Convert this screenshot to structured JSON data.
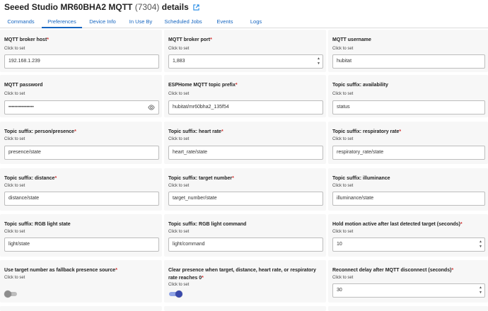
{
  "header": {
    "title": "Seeed Studio MR60BHA2 MQTT",
    "device_id": "(7304)",
    "suffix": "details",
    "link_icon": "external-link-icon"
  },
  "tabs": [
    {
      "label": "Commands"
    },
    {
      "label": "Preferences"
    },
    {
      "label": "Device Info"
    },
    {
      "label": "In Use By"
    },
    {
      "label": "Scheduled Jobs"
    },
    {
      "label": "Events"
    },
    {
      "label": "Logs"
    }
  ],
  "active_tab": "Preferences",
  "common": {
    "click_to_set": "Click to set",
    "required_mark": "*"
  },
  "prefs": {
    "broker_host": {
      "label": "MQTT broker host",
      "value": "192.168.1.239"
    },
    "broker_port": {
      "label": "MQTT broker port",
      "value": "1,883"
    },
    "username": {
      "label": "MQTT username",
      "value": "hubitat"
    },
    "password": {
      "label": "MQTT password",
      "value": "•••••••••••••••••"
    },
    "topic_prefix": {
      "label": "ESPHome MQTT topic prefix",
      "value": "hubitat/mr60bha2_135f54"
    },
    "availability": {
      "label": "Topic suffix: availability",
      "value": "status"
    },
    "presence": {
      "label": "Topic suffix: person/presence",
      "value": "presence/state"
    },
    "heart_rate": {
      "label": "Topic suffix: heart rate",
      "value": "heart_rate/state"
    },
    "resp_rate": {
      "label": "Topic suffix: respiratory rate",
      "value": "respiratory_rate/state"
    },
    "distance": {
      "label": "Topic suffix: distance",
      "value": "distance/state"
    },
    "target_number": {
      "label": "Topic suffix: target number",
      "value": "target_number/state"
    },
    "illuminance": {
      "label": "Topic suffix: illuminance",
      "value": "illuminance/state"
    },
    "rgb_state": {
      "label": "Topic suffix: RGB light state",
      "value": "light/state"
    },
    "rgb_command": {
      "label": "Topic suffix: RGB light command",
      "value": "light/command"
    },
    "hold_motion": {
      "label": "Hold motion active after last detected target (seconds)",
      "value": "10"
    },
    "fallback": {
      "label": "Use target number as fallback presence source",
      "state": "off"
    },
    "clear_presence": {
      "label": "Clear presence when target, distance, heart rate, or respiratory rate reaches 0",
      "state": "on"
    },
    "reconnect": {
      "label": "Reconnect delay after MQTT disconnect (seconds)",
      "value": "30"
    }
  },
  "colors": {
    "accent": "#1565c0",
    "required": "#d32f2f",
    "toggle_on": "#3949ab",
    "card_bg": "#f7f7f7"
  }
}
